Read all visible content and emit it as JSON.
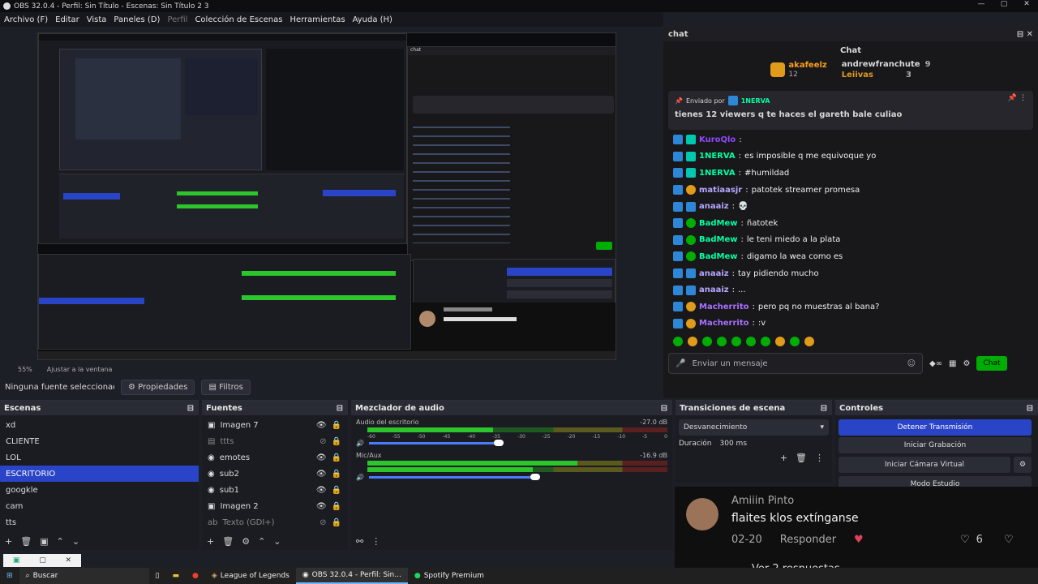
{
  "window": {
    "title": "OBS 32.0.4 - Perfil: Sin Título - Escenas: Sin Título 2 3"
  },
  "menu": [
    "Archivo (F)",
    "Editar",
    "Vista",
    "Paneles (D)",
    "Perfil",
    "Colección de Escenas",
    "Herramientas",
    "Ayuda (H)"
  ],
  "preview": {
    "zoom": "55%",
    "fit": "Ajustar a la ventana"
  },
  "source_toolbar": {
    "label": "Ninguna fuente seleccionad",
    "properties": "Propiedades",
    "filters": "Filtros"
  },
  "scenes": {
    "title": "Escenas",
    "items": [
      "xd",
      "CLIENTE",
      "LOL",
      "ESCRITORIO",
      "googkle",
      "cam",
      "tts"
    ],
    "selected": 3
  },
  "sources": {
    "title": "Fuentes",
    "items": [
      "Imagen 7",
      "ttts",
      "emotes",
      "sub2",
      "sub1",
      "Imagen 2",
      "Texto (GDI+)"
    ]
  },
  "mixer": {
    "title": "Mezclador de audio",
    "channels": [
      {
        "name": "Audio del escritorio",
        "db": "-27.0 dB",
        "level": 0.42
      },
      {
        "name": "Mic/Aux",
        "db": "-16.9 dB",
        "level": 0.7
      }
    ],
    "ticks": [
      "-60",
      "-55",
      "-50",
      "-45",
      "-40",
      "-35",
      "-30",
      "-25",
      "-20",
      "-15",
      "-10",
      "-5",
      "0"
    ]
  },
  "transitions": {
    "title": "Transiciones de escena",
    "selected": "Desvanecimiento",
    "duration_label": "Duración",
    "duration": "300 ms"
  },
  "controls": {
    "title": "Controles",
    "stop_stream": "Detener Transmisión",
    "start_rec": "Iniciar Grabación",
    "start_vcam": "Iniciar Cámara Virtual",
    "studio": "Modo Estudio"
  },
  "chat": {
    "dock_title": "chat",
    "header": "Chat",
    "leaders": [
      {
        "name": "akafeelz",
        "count": "12",
        "color": "#ff7f50"
      },
      {
        "name": "andrewfranchute",
        "count": "9",
        "color": "#ffffff"
      },
      {
        "name": "Leiivas",
        "count": "3",
        "color": "#e09b1a"
      }
    ],
    "pinned_by": "Enviado por",
    "pinned_user": "1NERVA",
    "pinned_text": "tienes 12 viewers q te haces el gareth bale culiao",
    "messages": [
      {
        "user": "KuroQlo",
        "text": "",
        "color": "#9147ff",
        "badge": "bsub"
      },
      {
        "user": "1NERVA",
        "text": "es imposible q me equivoque yo",
        "color": "#00ffa3",
        "badge": "bsub"
      },
      {
        "user": "1NERVA",
        "text": "#humildad",
        "color": "#00ffa3",
        "badge": "bsub"
      },
      {
        "user": "matiaasjr",
        "text": "patotek streamer promesa",
        "color": "#b5a8ff",
        "badge": "bgold"
      },
      {
        "user": "anaaiz",
        "text": "💀",
        "color": "#b5a8ff",
        "badge": "bprime"
      },
      {
        "user": "BadMew",
        "text": "ñatotek",
        "color": "#00ffa3",
        "badge": "bmod"
      },
      {
        "user": "BadMew",
        "text": "le teni miedo a la plata",
        "color": "#00ffa3",
        "badge": "bmod"
      },
      {
        "user": "BadMew",
        "text": "digamo la wea como es",
        "color": "#00ffa3",
        "badge": "bmod"
      },
      {
        "user": "anaaiz",
        "text": "tay pidiendo mucho",
        "color": "#b5a8ff",
        "badge": "bprime"
      },
      {
        "user": "anaaiz",
        "text": "...",
        "color": "#b5a8ff",
        "badge": "bprime"
      },
      {
        "user": "Macherrito",
        "text": "pero pq no muestras al bana?",
        "color": "#a970ff",
        "badge": "bgold"
      },
      {
        "user": "Macherrito",
        "text": ":v",
        "color": "#a970ff",
        "badge": "bgold"
      }
    ],
    "input_placeholder": "Enviar un mensaje",
    "send": "Chat"
  },
  "comment": {
    "author": "Amiiin Pinto",
    "text": "flaites klos extínganse",
    "date": "02-20",
    "reply": "Responder",
    "likes": "6",
    "more": "Ver 2 respuestas"
  },
  "taskbar": {
    "search": "Buscar",
    "apps": [
      "League of Legends",
      "OBS 32.0.4 - Perfil: Sin...",
      "Spotify Premium"
    ]
  },
  "colors": {
    "accent": "#2a44c8",
    "chat_green": "#00ad03"
  }
}
